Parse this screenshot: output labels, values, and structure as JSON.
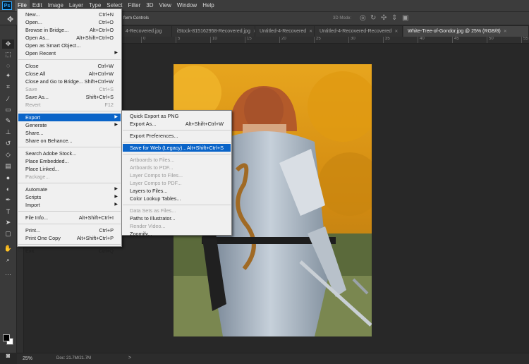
{
  "app": {
    "logo": "Ps"
  },
  "menubar": [
    "File",
    "Edit",
    "Image",
    "Layer",
    "Type",
    "Select",
    "Filter",
    "3D",
    "View",
    "Window",
    "Help"
  ],
  "options_bar": {
    "transform_label": "form Controls",
    "mode3d_label": "3D Mode:"
  },
  "tabs": [
    {
      "label": "4-Recovered.jpg",
      "active": false
    },
    {
      "label": "iStock-815162958-Recovered.jpg",
      "active": false
    },
    {
      "label": "Untitled-4-Recovered",
      "active": false
    },
    {
      "label": "Untitled-4-Recovered-Recovered",
      "active": false
    },
    {
      "label": "White-Tree-of-Gondor.jpg @ 25% (RGB/8)",
      "active": true
    }
  ],
  "ruler_ticks": [
    "0",
    "5",
    "10",
    "15",
    "20",
    "25",
    "30",
    "35",
    "40",
    "45",
    "50",
    "55"
  ],
  "status": {
    "zoom": "25%",
    "doc_size": "Doc: 21.7M/21.7M",
    "arrow": ">"
  },
  "file_menu": [
    {
      "label": "New...",
      "shortcut": "Ctrl+N"
    },
    {
      "label": "Open...",
      "shortcut": "Ctrl+O"
    },
    {
      "label": "Browse in Bridge...",
      "shortcut": "Alt+Ctrl+O"
    },
    {
      "label": "Open As...",
      "shortcut": "Alt+Shift+Ctrl+O"
    },
    {
      "label": "Open as Smart Object..."
    },
    {
      "label": "Open Recent",
      "submenu": true
    },
    {
      "separator": true
    },
    {
      "label": "Close",
      "shortcut": "Ctrl+W"
    },
    {
      "label": "Close All",
      "shortcut": "Alt+Ctrl+W"
    },
    {
      "label": "Close and Go to Bridge...",
      "shortcut": "Shift+Ctrl+W"
    },
    {
      "label": "Save",
      "shortcut": "Ctrl+S",
      "disabled": true
    },
    {
      "label": "Save As...",
      "shortcut": "Shift+Ctrl+S"
    },
    {
      "label": "Revert",
      "shortcut": "F12",
      "disabled": true
    },
    {
      "separator": true
    },
    {
      "label": "Export",
      "submenu": true,
      "highlight": true
    },
    {
      "label": "Generate",
      "submenu": true
    },
    {
      "label": "Share..."
    },
    {
      "label": "Share on Behance..."
    },
    {
      "separator": true
    },
    {
      "label": "Search Adobe Stock..."
    },
    {
      "label": "Place Embedded..."
    },
    {
      "label": "Place Linked..."
    },
    {
      "label": "Package...",
      "disabled": true
    },
    {
      "separator": true
    },
    {
      "label": "Automate",
      "submenu": true
    },
    {
      "label": "Scripts",
      "submenu": true
    },
    {
      "label": "Import",
      "submenu": true
    },
    {
      "separator": true
    },
    {
      "label": "File Info...",
      "shortcut": "Alt+Shift+Ctrl+I"
    },
    {
      "separator": true
    },
    {
      "label": "Print...",
      "shortcut": "Ctrl+P"
    },
    {
      "label": "Print One Copy",
      "shortcut": "Alt+Shift+Ctrl+P"
    },
    {
      "separator": true
    },
    {
      "label": "Exit",
      "shortcut": "Ctrl+Q"
    }
  ],
  "export_menu": [
    {
      "label": "Quick Export as PNG"
    },
    {
      "label": "Export As...",
      "shortcut": "Alt+Shift+Ctrl+W"
    },
    {
      "separator": true
    },
    {
      "label": "Export Preferences..."
    },
    {
      "separator": true
    },
    {
      "label": "Save for Web (Legacy)...",
      "shortcut": "Alt+Shift+Ctrl+S",
      "highlight": true
    },
    {
      "separator": true
    },
    {
      "label": "Artboards to Files...",
      "disabled": true
    },
    {
      "label": "Artboards to PDF...",
      "disabled": true
    },
    {
      "label": "Layer Comps to Files...",
      "disabled": true
    },
    {
      "label": "Layer Comps to PDF...",
      "disabled": true
    },
    {
      "label": "Layers to Files..."
    },
    {
      "label": "Color Lookup Tables..."
    },
    {
      "separator": true
    },
    {
      "label": "Data Sets as Files...",
      "disabled": true
    },
    {
      "label": "Paths to Illustrator..."
    },
    {
      "label": "Render Video...",
      "disabled": true
    },
    {
      "label": "Zoomify..."
    }
  ],
  "colors": {
    "highlight": "#0a64c8",
    "menu_bg": "#f0f0f0",
    "chrome": "#3c3c3c",
    "workspace": "#282828"
  }
}
